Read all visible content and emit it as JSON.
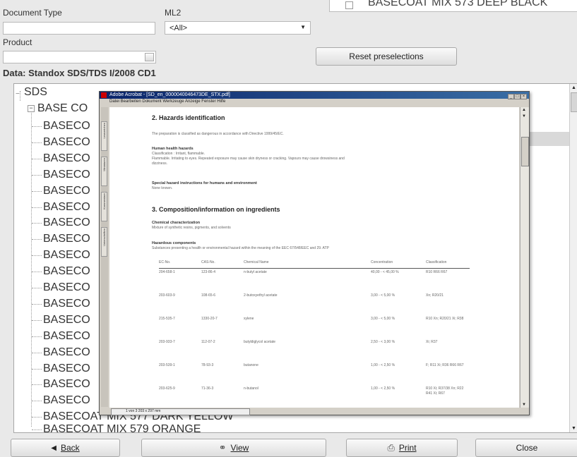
{
  "filters": {
    "document_type_label": "Document Type",
    "ml2_label": "ML2",
    "ml2_value": "<All>",
    "product_label": "Product",
    "reset_label": "Reset preselections"
  },
  "background_item": "BASECOAT MIX 573 DEEP BLACK",
  "data_label": "Data: Standox SDS/TDS I/2008 CD1",
  "tree": {
    "root": "SDS",
    "group": "BASE CO",
    "items": [
      "BASECO",
      "BASECO",
      "BASECO",
      "BASECO",
      "BASECO",
      "BASECO",
      "BASECO",
      "BASECO",
      "BASECO",
      "BASECO",
      "BASECO",
      "BASECO",
      "BASECO",
      "BASECO",
      "BASECO",
      "BASECO",
      "BASECO",
      "BASECO"
    ],
    "tail_1": "BASECOAT MIX 577 DARK YELLOW",
    "tail_2": "BASECOAT MIX 579 ORANGE"
  },
  "pdf": {
    "title": "Adobe Acrobat - [SD_en_0000040046473DE_STX.pdf]",
    "menu": "Datei  Bearbeiten  Dokument  Werkzeuge  Anzeige  Fenster  Hilfe",
    "side_tabs": [
      "Lesezeichen",
      "Miniaturen",
      "Kommentare",
      "Unterschriften"
    ],
    "h2": "2. Hazards identification",
    "p2": "The preparation is classified as dangerous in accordance with Directive 1999/45/EC.",
    "human_head": "Human health hazards",
    "human_text_1": "Classification : Irritant, flammable.",
    "human_text_2": "Flammable. Irritating to eyes. Repeated exposure may cause skin dryness or cracking. Vapours may cause drowsiness and",
    "human_text_3": "dizziness.",
    "special_head": "Special hazard instructions for humans and environment",
    "special_text": "None known.",
    "h3": "3. Composition/information on ingredients",
    "chem_head": "Chemical characterization",
    "chem_text": "Mixture of synthetic resins, pigments, and solvents",
    "haz_head": "Hazardous components",
    "haz_text": "Substances presenting a health or environmental hazard within the meaning of the EEC 67/548/EEC and 29. ATP",
    "table_headers": [
      "EC-No.",
      "CAS-No.",
      "Chemical Name",
      "Concentration",
      "Classification"
    ],
    "table_rows": [
      [
        "204-658-1",
        "123-86-4",
        "n-butyl acetate",
        "40,00 - < 45,00 %",
        "R10 R66 R67"
      ],
      [
        "203-603-9",
        "108-65-6",
        "2-butoxyethyl acetate",
        "3,00 - < 5,00 %",
        "Xn; R20/21"
      ],
      [
        "215-535-7",
        "1330-20-7",
        "xylene",
        "3,00 - < 5,00 %",
        "R10 Xn; R20/21 Xi; R38"
      ],
      [
        "203-933-7",
        "112-07-2",
        "butyldiglycol acetate",
        "2,50 - < 3,00 %",
        "Xi; R37"
      ],
      [
        "203-539-1",
        "78-93-3",
        "butanone",
        "1,00 - < 2,50 %",
        "F; R11 Xi; R36 R66 R67"
      ],
      [
        "203-625-9",
        "71-36-3",
        "n-butanol",
        "1,00 - < 2,50 %",
        "R10 Xi; R37/38 Xn; R22 R41 Xi; R67"
      ]
    ],
    "statusbar": "1 von 3    203 x 297 mm"
  },
  "buttons": {
    "back": "Back",
    "view": "View",
    "print": "Print",
    "close": "Close"
  }
}
